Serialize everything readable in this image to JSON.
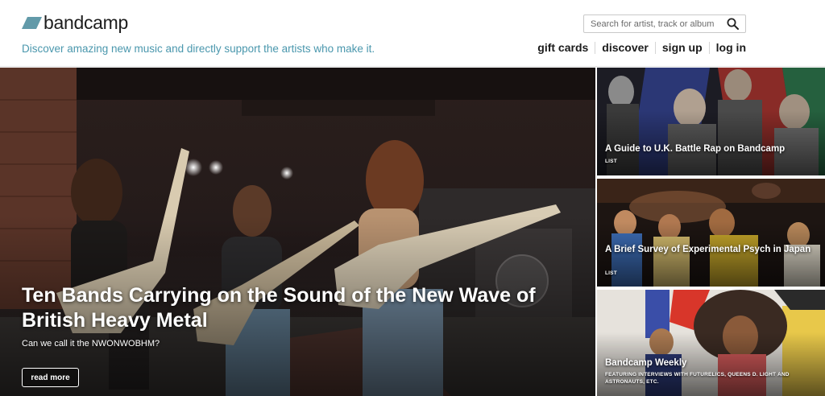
{
  "brand": {
    "name": "bandcamp",
    "tagline": "Discover amazing new music and directly support the artists who make it.",
    "accent": "#629aa9",
    "tagline_color": "#4a97ad"
  },
  "search": {
    "placeholder": "Search for artist, track or album",
    "value": "",
    "icon": "search-icon"
  },
  "nav": {
    "items": [
      {
        "label": "gift cards"
      },
      {
        "label": "discover"
      },
      {
        "label": "sign up"
      },
      {
        "label": "log in"
      }
    ]
  },
  "hero": {
    "title": "Ten Bands Carrying on the Sound of the New Wave of British Heavy Metal",
    "subtitle": "Can we call it the NWONWOBHM?",
    "button_label": "read more"
  },
  "side_stories": [
    {
      "title": "A Guide to U.K. Battle Rap on Bandcamp",
      "type": "LIST"
    },
    {
      "title": "A Brief Survey of Experimental Psych in Japan",
      "type": "LIST"
    },
    {
      "title": "Bandcamp Weekly",
      "type": "FEATURING INTERVIEWS WITH FUTURELICS, QUEENS D. LIGHT AND ASTRONAUTS, ETC."
    }
  ]
}
